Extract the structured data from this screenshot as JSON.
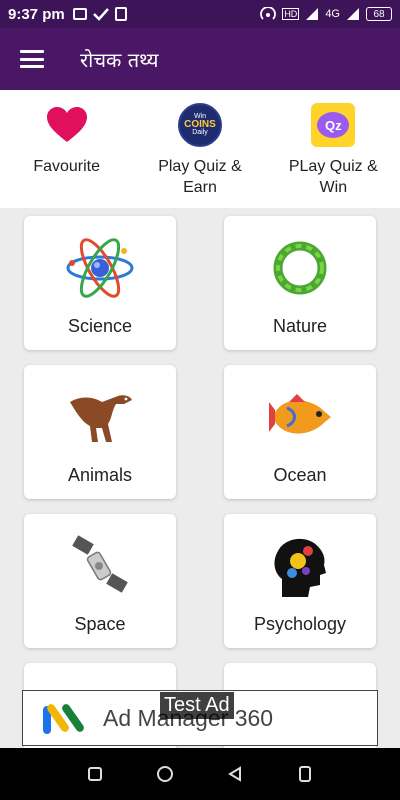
{
  "status_bar": {
    "time": "9:37 pm",
    "network": "4G",
    "battery": "68"
  },
  "app_bar": {
    "title": "रोचक तथ्य"
  },
  "quick_actions": [
    {
      "label": "Favourite",
      "icon": "heart-icon"
    },
    {
      "label": "Play Quiz & Earn",
      "icon": "win-coins-icon",
      "badge_top": "Win",
      "badge_mid": "COINS",
      "badge_bottom": "Daily"
    },
    {
      "label": "PLay Quiz & Win",
      "icon": "qz-icon",
      "badge": "Qz"
    }
  ],
  "categories": [
    {
      "label": "Science",
      "icon": "atom-icon"
    },
    {
      "label": "Nature",
      "icon": "leaf-wreath-icon"
    },
    {
      "label": "Animals",
      "icon": "dinosaur-icon"
    },
    {
      "label": "Ocean",
      "icon": "fish-icon"
    },
    {
      "label": "Space",
      "icon": "satellite-icon"
    },
    {
      "label": "Psychology",
      "icon": "head-gears-icon"
    },
    {
      "label": "",
      "icon": ""
    },
    {
      "label": "",
      "icon": ""
    }
  ],
  "ad": {
    "text": "Ad Manager 360",
    "overlay": "Test Ad"
  },
  "colors": {
    "status_bar": "#3e1458",
    "app_bar": "#4a1766",
    "heart": "#e0105e",
    "background": "#ececec"
  }
}
